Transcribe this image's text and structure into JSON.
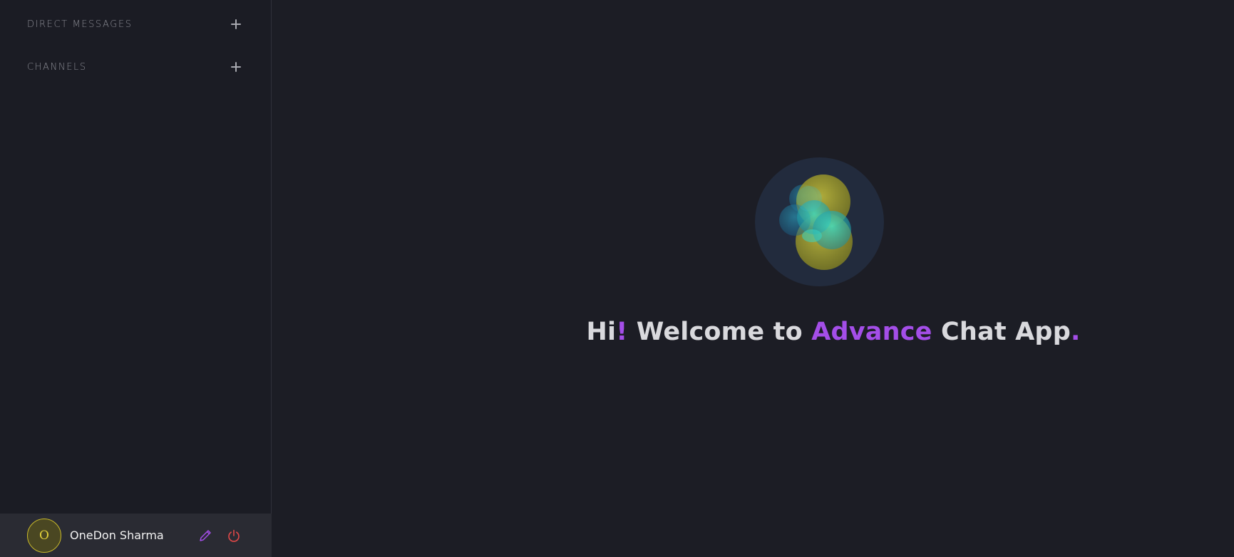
{
  "sidebar": {
    "direct_messages_title": "DIRECT MESSAGES",
    "channels_title": "CHANNELS",
    "add_icon": "plus-icon"
  },
  "profile": {
    "avatar_initial": "O",
    "name": "OneDon Sharma",
    "edit_icon": "pencil-icon",
    "logout_icon": "power-icon"
  },
  "welcome": {
    "part1": "Hi",
    "excl": "!",
    "part2": " Welcome to ",
    "highlight": "Advance",
    "part3": " Chat App",
    "dot": "."
  },
  "colors": {
    "accent": "#a44ee8",
    "logout": "#e04848",
    "avatar_border": "#c9b92a",
    "background": "#1c1d25"
  }
}
